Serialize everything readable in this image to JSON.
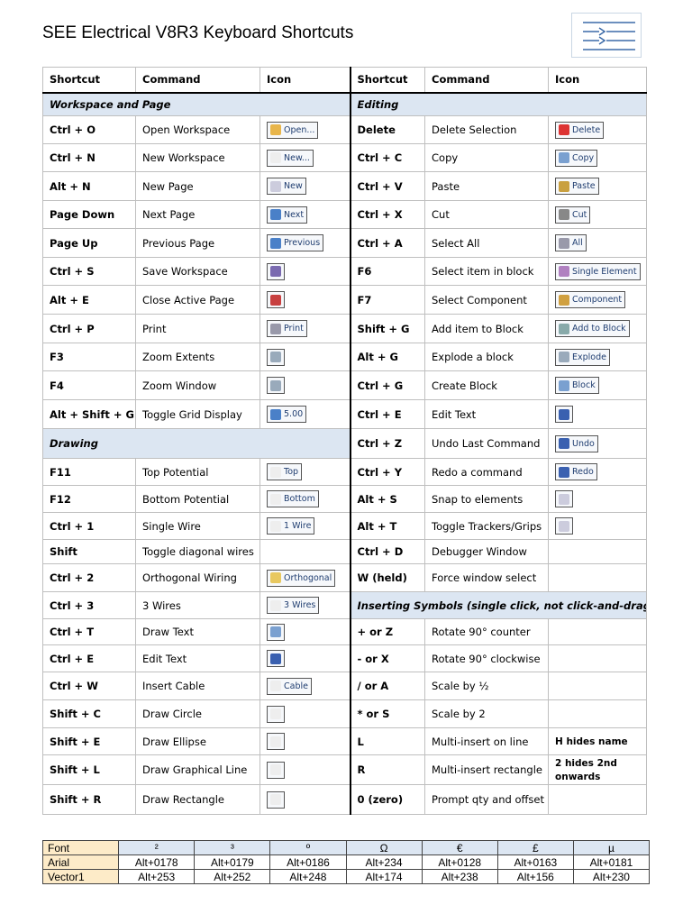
{
  "title": "SEE Electrical V8R3 Keyboard Shortcuts",
  "headers": [
    "Shortcut",
    "Command",
    "Icon",
    "Shortcut",
    "Command",
    "Icon"
  ],
  "rows": [
    {
      "left": {
        "section": "Workspace and Page"
      },
      "right": {
        "section": "Editing"
      }
    },
    {
      "left": {
        "key": "Ctrl + O",
        "cmd": "Open Workspace",
        "icon": "Open...",
        "color": "#e8b54a"
      },
      "right": {
        "key": "Delete",
        "cmd": "Delete Selection",
        "icon": "Delete",
        "color": "#d33"
      }
    },
    {
      "left": {
        "key": "Ctrl + N",
        "cmd": "New Workspace",
        "icon": "New...",
        "color": "#eee"
      },
      "right": {
        "key": "Ctrl + C",
        "cmd": "Copy",
        "icon": "Copy",
        "color": "#7aa0d0"
      }
    },
    {
      "left": {
        "key": "Alt + N",
        "cmd": "New Page",
        "icon": "New",
        "color": "#ccd"
      },
      "right": {
        "key": "Ctrl + V",
        "cmd": "Paste",
        "icon": "Paste",
        "color": "#c9a040"
      }
    },
    {
      "left": {
        "key": "Page Down",
        "cmd": "Next Page",
        "icon": "Next",
        "color": "#4a80c8"
      },
      "right": {
        "key": "Ctrl + X",
        "cmd": "Cut",
        "icon": "Cut",
        "color": "#888"
      }
    },
    {
      "left": {
        "key": "Page Up",
        "cmd": "Previous Page",
        "icon": "Previous",
        "color": "#4a80c8"
      },
      "right": {
        "key": "Ctrl + A",
        "cmd": "Select All",
        "icon": "All",
        "color": "#99a"
      }
    },
    {
      "left": {
        "key": "Ctrl + S",
        "cmd": "Save Workspace",
        "icon": "",
        "color": "#7a6ab0"
      },
      "right": {
        "key": "F6",
        "cmd": "Select item in block",
        "icon": "Single Element",
        "color": "#b080c0"
      }
    },
    {
      "left": {
        "key": "Alt + E",
        "cmd": "Close Active Page",
        "icon": "",
        "color": "#c84040"
      },
      "right": {
        "key": "F7",
        "cmd": "Select Component",
        "icon": "Component",
        "color": "#d0a040"
      }
    },
    {
      "left": {
        "key": "Ctrl + P",
        "cmd": "Print",
        "icon": "Print",
        "color": "#99a"
      },
      "right": {
        "key": "Shift + G",
        "cmd": "Add item to Block",
        "icon": "Add to Block",
        "color": "#8aa"
      }
    },
    {
      "left": {
        "key": "F3",
        "cmd": "Zoom Extents",
        "icon": "",
        "color": "#9ab"
      },
      "right": {
        "key": "Alt + G",
        "cmd": "Explode a block",
        "icon": "Explode",
        "color": "#9ab"
      }
    },
    {
      "left": {
        "key": "F4",
        "cmd": "Zoom Window",
        "icon": "",
        "color": "#9ab"
      },
      "right": {
        "key": "Ctrl + G",
        "cmd": "Create Block",
        "icon": "Block",
        "color": "#7aa0d0"
      }
    },
    {
      "left": {
        "key": "Alt + Shift + G",
        "cmd": "Toggle Grid Display",
        "icon": "5.00",
        "color": "#4a80c8"
      },
      "right": {
        "key": "Ctrl + E",
        "cmd": "Edit Text",
        "icon": "",
        "color": "#3a60b0"
      }
    },
    {
      "left": {
        "section": "Drawing"
      },
      "right": {
        "key": "Ctrl + Z",
        "cmd": "Undo Last Command",
        "icon": "Undo",
        "color": "#3a60b0"
      }
    },
    {
      "left": {
        "key": "F11",
        "cmd": "Top Potential",
        "icon": "Top",
        "color": "#eee"
      },
      "right": {
        "key": "Ctrl + Y",
        "cmd": "Redo a command",
        "icon": "Redo",
        "color": "#3a60b0"
      }
    },
    {
      "left": {
        "key": "F12",
        "cmd": "Bottom Potential",
        "icon": "Bottom",
        "color": "#eee"
      },
      "right": {
        "key": "Alt + S",
        "cmd": "Snap to elements",
        "icon": "",
        "color": "#ccd"
      }
    },
    {
      "left": {
        "key": "Ctrl + 1",
        "cmd": "Single Wire",
        "icon": "1 Wire",
        "color": "#eee"
      },
      "right": {
        "key": "Alt + T",
        "cmd": "Toggle Trackers/Grips",
        "icon": "",
        "color": "#ccd"
      }
    },
    {
      "left": {
        "key": "Shift",
        "cmd": "Toggle diagonal wires"
      },
      "right": {
        "key": "Ctrl + D",
        "cmd": "Debugger Window"
      }
    },
    {
      "left": {
        "key": "Ctrl + 2",
        "cmd": "Orthogonal Wiring",
        "icon": "Orthogonal",
        "color": "#e8c860"
      },
      "right": {
        "key": "W (held)",
        "cmd": "Force window select"
      }
    },
    {
      "left": {
        "key": "Ctrl + 3",
        "cmd": "3 Wires",
        "icon": "3 Wires",
        "color": "#eee"
      },
      "right": {
        "section": "Inserting Symbols (single click, not click-and-drag)"
      }
    },
    {
      "left": {
        "key": "Ctrl + T",
        "cmd": "Draw Text",
        "icon": "",
        "color": "#7aa0d0"
      },
      "right": {
        "key": "+ or Z",
        "cmd": "Rotate 90° counter"
      }
    },
    {
      "left": {
        "key": "Ctrl + E",
        "cmd": "Edit Text",
        "icon": "",
        "color": "#3a60b0"
      },
      "right": {
        "key": "- or X",
        "cmd": "Rotate 90° clockwise"
      }
    },
    {
      "left": {
        "key": "Ctrl + W",
        "cmd": "Insert Cable",
        "icon": "Cable",
        "color": "#eee"
      },
      "right": {
        "key": "/  or A",
        "cmd": "Scale by ½"
      }
    },
    {
      "left": {
        "key": "Shift + C",
        "cmd": "Draw Circle",
        "icon": "",
        "color": "#eee"
      },
      "right": {
        "key": "* or S",
        "cmd": "Scale by 2"
      }
    },
    {
      "left": {
        "key": "Shift + E",
        "cmd": "Draw Ellipse",
        "icon": "",
        "color": "#eee"
      },
      "right": {
        "key": "L",
        "cmd": "Multi-insert on line",
        "note": "H hides name"
      }
    },
    {
      "left": {
        "key": "Shift + L",
        "cmd": "Draw Graphical Line",
        "icon": "",
        "color": "#eee"
      },
      "right": {
        "key": "R",
        "cmd": "Multi-insert rectangle",
        "note": "2 hides 2nd onwards"
      }
    },
    {
      "left": {
        "key": "Shift + R",
        "cmd": "Draw Rectangle",
        "icon": "",
        "color": "#eee"
      },
      "right": {
        "key": "0 (zero)",
        "cmd": "Prompt qty and offset"
      }
    }
  ],
  "fonts": {
    "header": [
      "Font",
      "²",
      "³",
      "º",
      "Ω",
      "€",
      "£",
      "µ"
    ],
    "rows": [
      [
        "Arial",
        "Alt+0178",
        "Alt+0179",
        "Alt+0186",
        "Alt+234",
        "Alt+0128",
        "Alt+0163",
        "Alt+0181"
      ],
      [
        "Vector1",
        "Alt+253",
        "Alt+252",
        "Alt+248",
        "Alt+174",
        "Alt+238",
        "Alt+156",
        "Alt+230"
      ]
    ]
  }
}
